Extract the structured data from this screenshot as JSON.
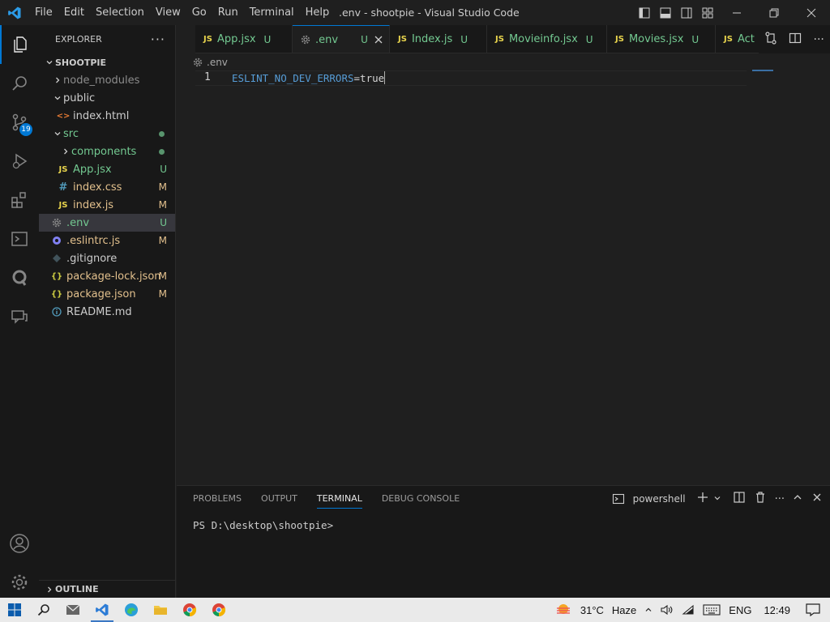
{
  "window": {
    "title": ".env - shootpie - Visual Studio Code",
    "menu": [
      "File",
      "Edit",
      "Selection",
      "View",
      "Go",
      "Run",
      "Terminal",
      "Help"
    ]
  },
  "activity": {
    "scm_badge": "19"
  },
  "sidebar": {
    "title": "EXPLORER",
    "root": "SHOOTPIE",
    "items": [
      {
        "label": "node_modules",
        "status": ""
      },
      {
        "label": "public",
        "status": ""
      },
      {
        "label": "index.html",
        "status": ""
      },
      {
        "label": "src",
        "status": ""
      },
      {
        "label": "components",
        "status": ""
      },
      {
        "label": "App.jsx",
        "status": "U"
      },
      {
        "label": "index.css",
        "status": "M"
      },
      {
        "label": "index.js",
        "status": "M"
      },
      {
        "label": ".env",
        "status": "U"
      },
      {
        "label": ".eslintrc.js",
        "status": "M"
      },
      {
        "label": ".gitignore",
        "status": ""
      },
      {
        "label": "package-lock.json",
        "status": "M"
      },
      {
        "label": "package.json",
        "status": "M"
      },
      {
        "label": "README.md",
        "status": ""
      }
    ],
    "outline": "OUTLINE"
  },
  "tabs": [
    {
      "label": "App.jsx",
      "status": "U"
    },
    {
      "label": ".env",
      "status": "U"
    },
    {
      "label": "Index.js",
      "status": "U"
    },
    {
      "label": "Movieinfo.jsx",
      "status": "U"
    },
    {
      "label": "Movies.jsx",
      "status": "U"
    },
    {
      "label": "Act",
      "status": ""
    }
  ],
  "editor": {
    "breadcrumb": ".env",
    "line_number": "1",
    "code_key": "ESLINT_NO_DEV_ERRORS",
    "code_eq": "=",
    "code_val": "true"
  },
  "panel": {
    "tabs": [
      "PROBLEMS",
      "OUTPUT",
      "TERMINAL",
      "DEBUG CONSOLE"
    ],
    "shell": "powershell",
    "prompt": "PS D:\\desktop\\shootpie>"
  },
  "taskbar": {
    "temperature": "31°C",
    "weather": "Haze",
    "language": "ENG",
    "time": "12:49"
  },
  "colors": {
    "accent": "#0078d4",
    "untracked": "#73c991",
    "modified": "#e2c08d",
    "js_yellow": "#e8d44d"
  }
}
